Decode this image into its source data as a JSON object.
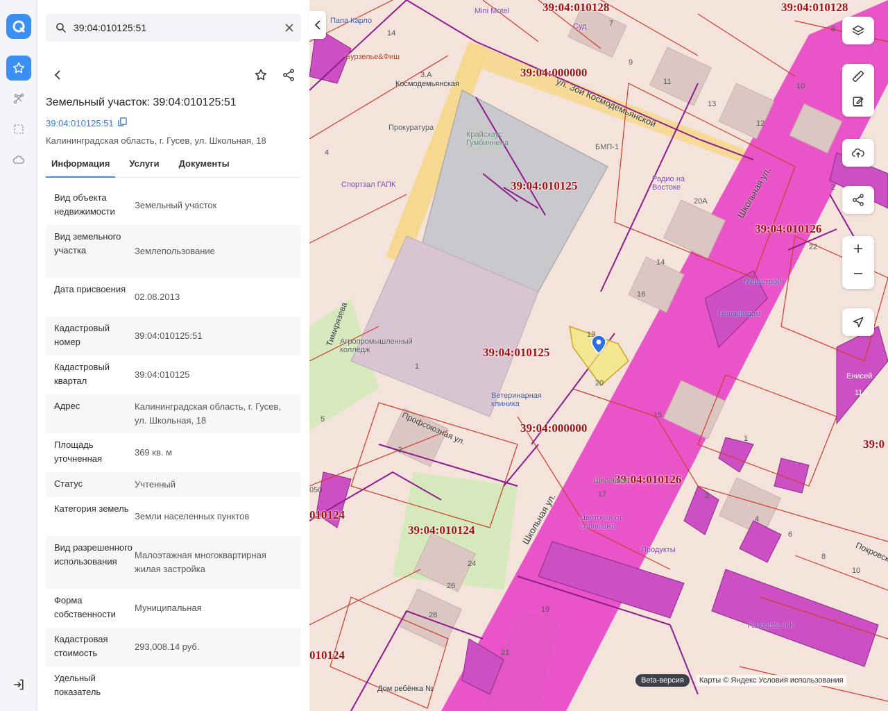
{
  "search": {
    "value": "39:04:010125:51"
  },
  "header": {
    "title": "Земельный участок: 39:04:010125:51",
    "cad_link": "39:04:010125:51",
    "address": "Калининградская область, г. Гусев, ул. Школьная, 18"
  },
  "tabs": [
    {
      "label": "Информация"
    },
    {
      "label": "Услуги"
    },
    {
      "label": "Документы"
    }
  ],
  "rows": [
    {
      "key": "Вид объекта недвижимости",
      "value": "Земельный участок"
    },
    {
      "key": "Вид земельного участка",
      "value": "Землепользование"
    },
    {
      "key": "Дата присвоения",
      "value": "02.08.2013"
    },
    {
      "key": "Кадастровый номер",
      "value": "39:04:010125:51"
    },
    {
      "key": "Кадастровый квартал",
      "value": "39:04:010125"
    },
    {
      "key": "Адрес",
      "value": "Калининградская область, г. Гусев, ул. Школьная, 18"
    },
    {
      "key": "Площадь уточненная",
      "value": "369 кв. м"
    },
    {
      "key": "Статус",
      "value": "Учтенный"
    },
    {
      "key": "Категория земель",
      "value": "Земли населенных пунктов"
    },
    {
      "key": "Вид разрешенного использования",
      "value": "Малоэтажная многоквартирная жилая застройка"
    },
    {
      "key": "Форма собственности",
      "value": "Муниципальная"
    },
    {
      "key": "Кадастровая стоимость",
      "value": "293,008.14 руб."
    },
    {
      "key": "Удельный показатель",
      "value": ""
    }
  ],
  "map": {
    "cad_labels": [
      "39:04:010128",
      "39:04:010128",
      "39:04:000000",
      "39:04:010125",
      "39:04:010126",
      "39:04:010125",
      "39:04:000000",
      "39:04:010126",
      "39:04:010124",
      "010124",
      "010124",
      "39:0"
    ],
    "pois": [
      "Mini Motel",
      "Суд",
      "Папа Карло",
      "Бурзелье&Фиш",
      "Космодемьянская",
      "Прокуратура",
      "Крайсхаус Гумбиннена",
      "БМП-1",
      "Спортзал ГАПК",
      "Радио на Востоке",
      "Мегастрой",
      "Тёплый дом",
      "Агропромышленный колледж",
      "Ветеринарная клиника",
      "Енисей",
      "Школьная",
      "Цветочки от солнышка",
      "Продукты",
      "Ганбаров и К",
      "Дом ребёнка №"
    ],
    "streets": [
      "ул. Зои Космодемьянской",
      "Школьная ул.",
      "Профсоюзная ул.",
      "Школьная ул.",
      "Тимирязева",
      "Покровск"
    ],
    "house_numbers": [
      "14",
      "7",
      "9",
      "11",
      "13",
      "12",
      "8",
      "10",
      "20А",
      "22",
      "14",
      "16",
      "13",
      "20",
      "15",
      "1",
      "2",
      "4",
      "6",
      "8",
      "10",
      "5",
      "2",
      "17",
      "24",
      "26",
      "28",
      "19",
      "21",
      "11А",
      "4",
      "1",
      "2",
      "3.А",
      "050"
    ],
    "beta": "Beta-версия",
    "attribution": "Карты © Яндекс   Условия использования"
  },
  "colors": {
    "accent": "#3b8ff3",
    "road_highlight": "#e830c6",
    "parcel_line": "#cc3b2a",
    "selected_parcel": "#f3e878"
  }
}
